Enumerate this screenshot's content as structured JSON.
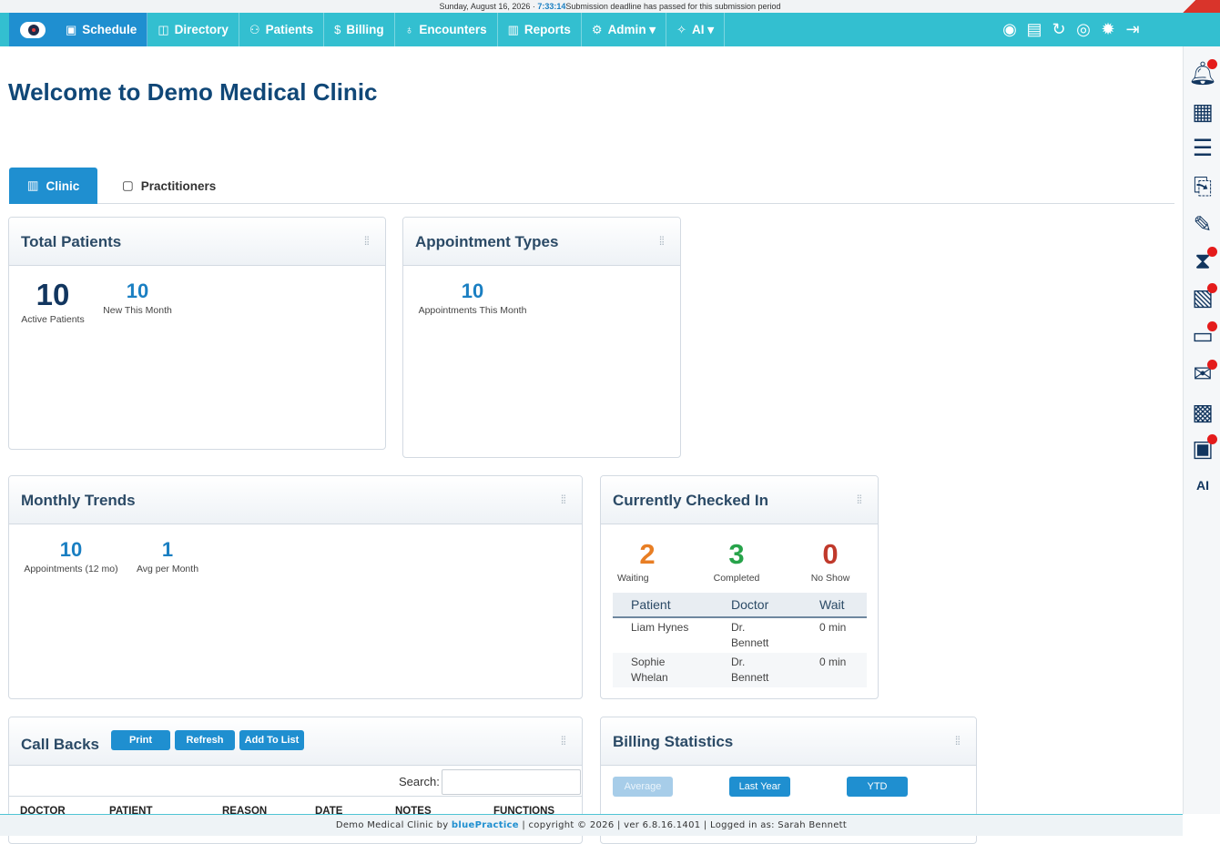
{
  "topbar": {
    "date": "Sunday, August 16, 2026 · ",
    "time": "7:33:14",
    "notice": "Submission deadline has passed for this submission period"
  },
  "nav": {
    "items": [
      {
        "label": "Schedule",
        "icon": "calendar-icon"
      },
      {
        "label": "Directory",
        "icon": "book-icon"
      },
      {
        "label": "Patients",
        "icon": "users-icon"
      },
      {
        "label": "Billing",
        "icon": "dollar-icon"
      },
      {
        "label": "Encounters",
        "icon": "stethoscope-icon"
      },
      {
        "label": "Reports",
        "icon": "bar-chart-icon"
      },
      {
        "label": "Admin ▾",
        "icon": "gear-icon"
      },
      {
        "label": "AI ▾",
        "icon": "sparkle-icon"
      }
    ],
    "right_icons": [
      "bp-logo-icon",
      "document-icon",
      "refresh-icon",
      "eye-icon",
      "settings-icon",
      "logout-icon"
    ]
  },
  "welcome_title": "Welcome to Demo Medical Clinic",
  "tabs": [
    {
      "label": "Clinic"
    },
    {
      "label": "Practitioners"
    }
  ],
  "total_patients": {
    "title": "Total Patients",
    "active": "10",
    "active_label": "Active Patients",
    "new": "10",
    "new_label": "New This Month"
  },
  "appointment_types": {
    "title": "Appointment Types",
    "value": "10",
    "label": "Appointments This Month"
  },
  "monthly_trends": {
    "title": "Monthly Trends",
    "appointments": "10",
    "appointments_label": "Appointments (12 mo)",
    "avg": "1",
    "avg_label": "Avg per Month"
  },
  "checked_in": {
    "title": "Currently Checked In",
    "waiting": "2",
    "waiting_label": "Waiting",
    "completed": "3",
    "completed_label": "Completed",
    "no_show": "0",
    "no_show_label": "No Show",
    "headers": [
      "Patient",
      "Doctor",
      "Wait"
    ],
    "rows": [
      {
        "patient": "Liam Hynes",
        "doctor": "Dr. Bennett",
        "wait": "0 min"
      },
      {
        "patient": "Sophie Whelan",
        "doctor": "Dr. Bennett",
        "wait": "0 min"
      }
    ]
  },
  "call_backs": {
    "title": "Call Backs",
    "print": "Print",
    "refresh": "Refresh",
    "add": "Add To List",
    "search_label": "Search:",
    "headers": [
      "DOCTOR",
      "PATIENT",
      "REASON",
      "DATE",
      "NOTES",
      "FUNCTIONS"
    ]
  },
  "billing_stats": {
    "title": "Billing Statistics",
    "average": "Average",
    "last_year": "Last Year",
    "ytd": "YTD"
  },
  "footer": {
    "prefix": "Demo Medical Clinic by ",
    "brand": "bluePractice",
    "suffix": "  |  copyright © 2026  |  ver 6.8.16.1401  |  Logged in as: Sarah Bennett"
  },
  "colors": {
    "nav": "#33bfd0",
    "primary": "#1f8fd0",
    "waiting": "#e87e24",
    "completed": "#27a34a",
    "no_show": "#c0392b",
    "stat_blue": "#1a7fc2",
    "heading": "#104777"
  }
}
